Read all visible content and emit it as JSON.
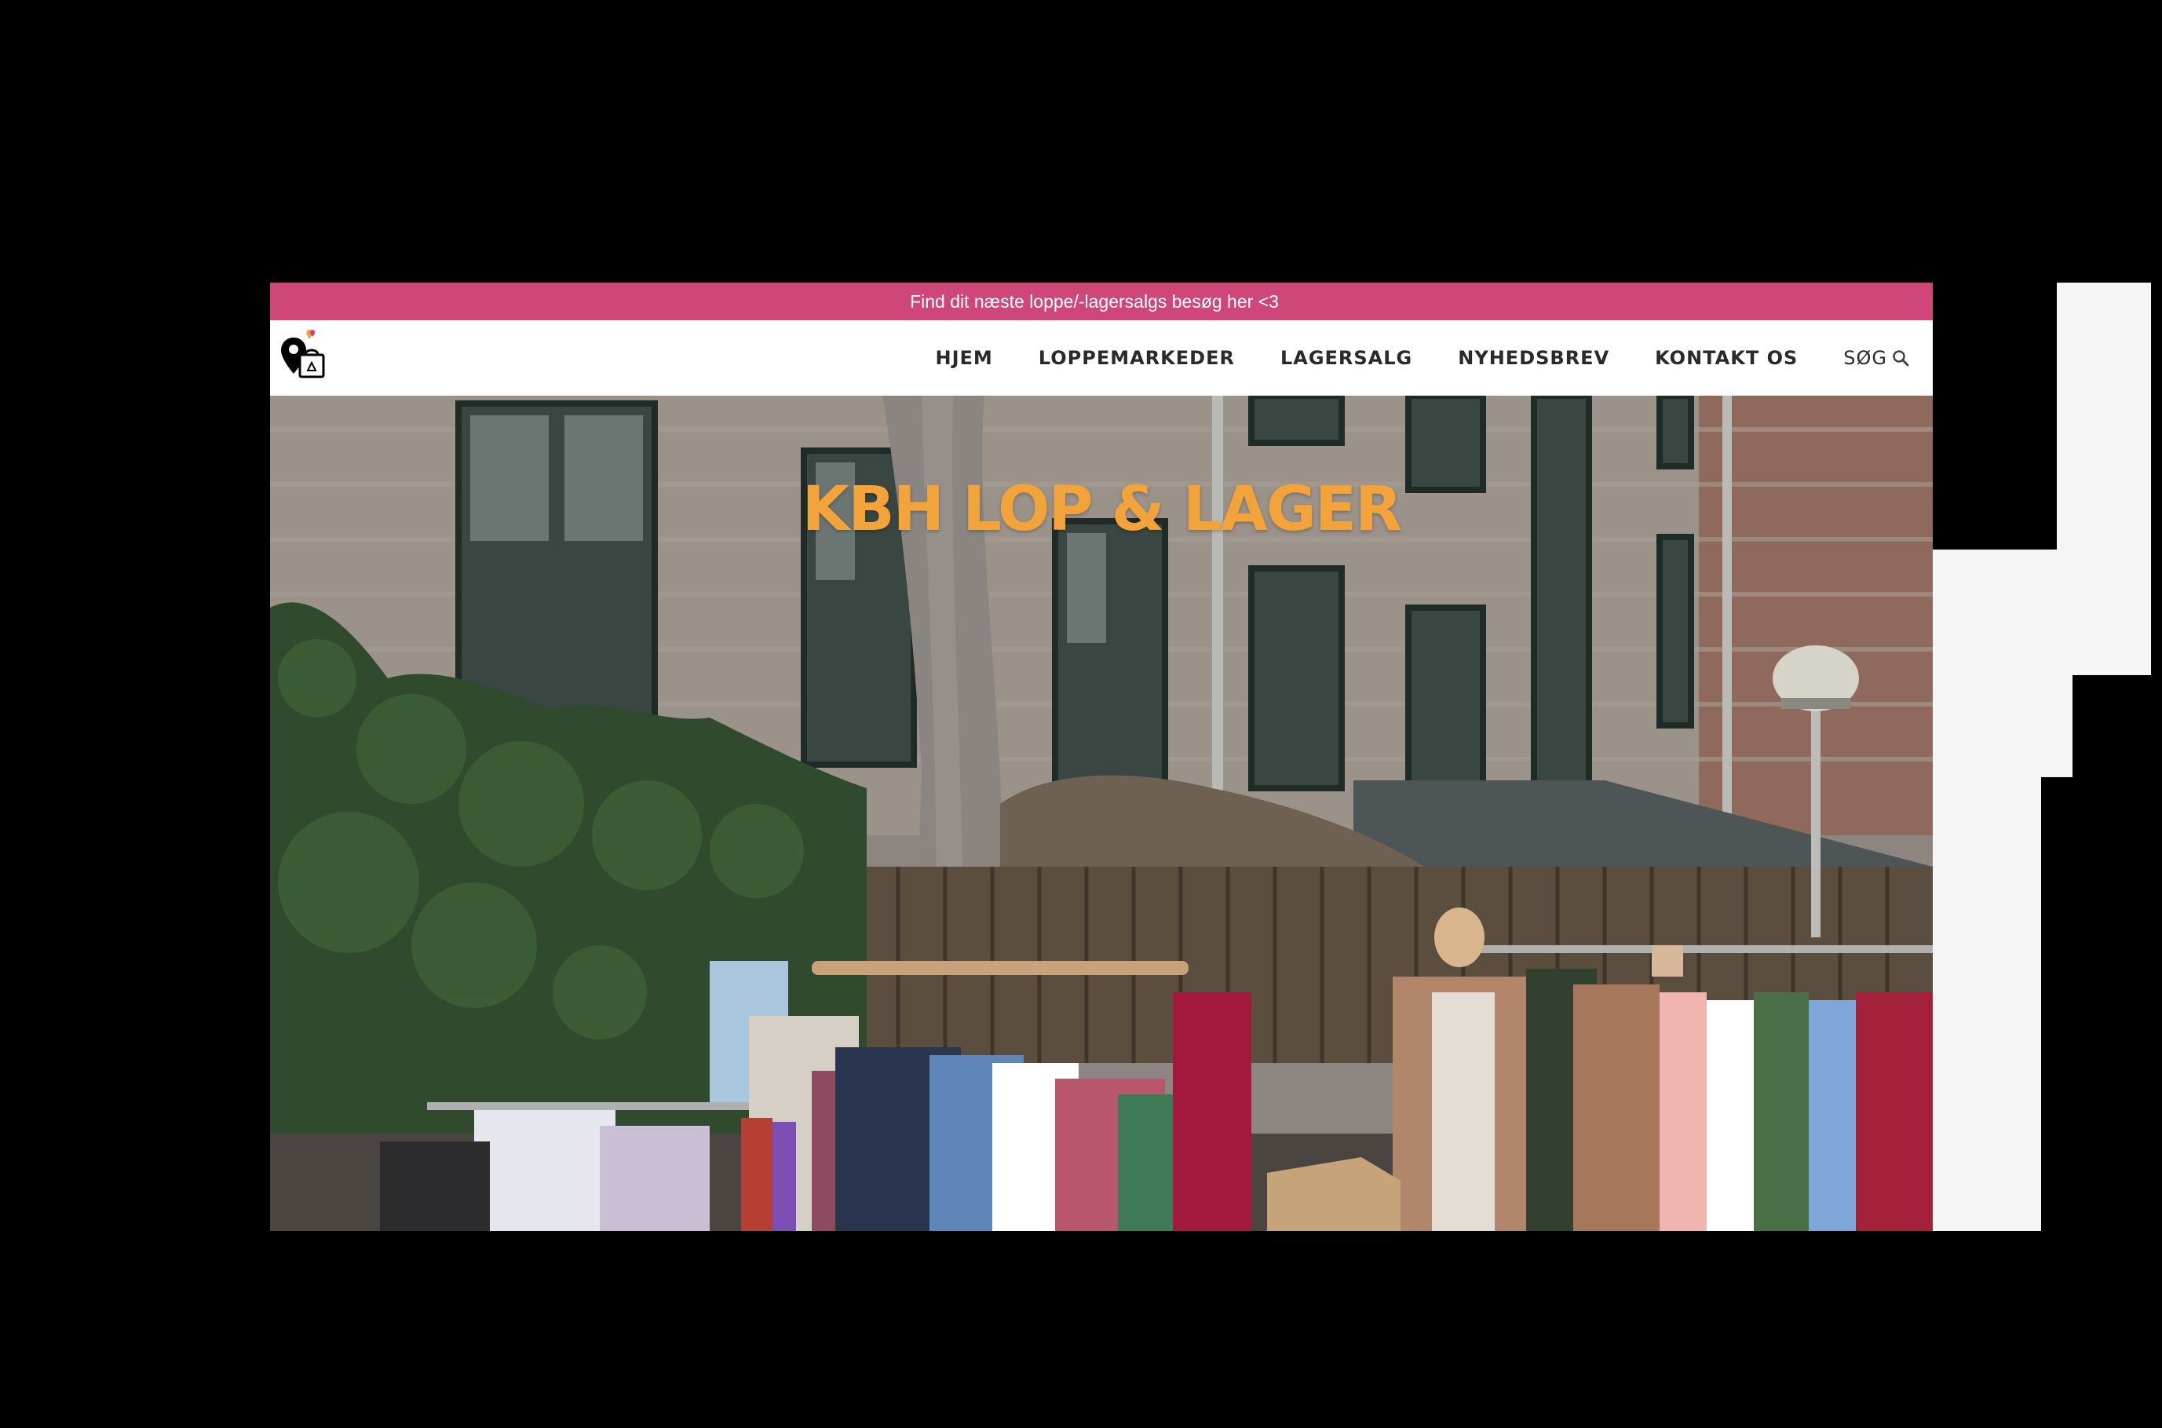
{
  "announcement": {
    "text": "Find dit næste loppe/-lagersalgs besøg her <3"
  },
  "nav": {
    "items": [
      {
        "label": "HJEM"
      },
      {
        "label": "LOPPEMARKEDER"
      },
      {
        "label": "LAGERSALG"
      },
      {
        "label": "NYHEDSBREV"
      },
      {
        "label": "KONTAKT OS"
      }
    ],
    "search_label": "SØG"
  },
  "hero": {
    "title": "KBH LOP & LAGER"
  },
  "icons": {
    "logo": "location-pin-shopping-bag-logo",
    "search": "search-icon"
  },
  "colors": {
    "announcement_bg": "#cf4778",
    "title": "#f2a33a",
    "nav_text": "#2a2a2a"
  }
}
